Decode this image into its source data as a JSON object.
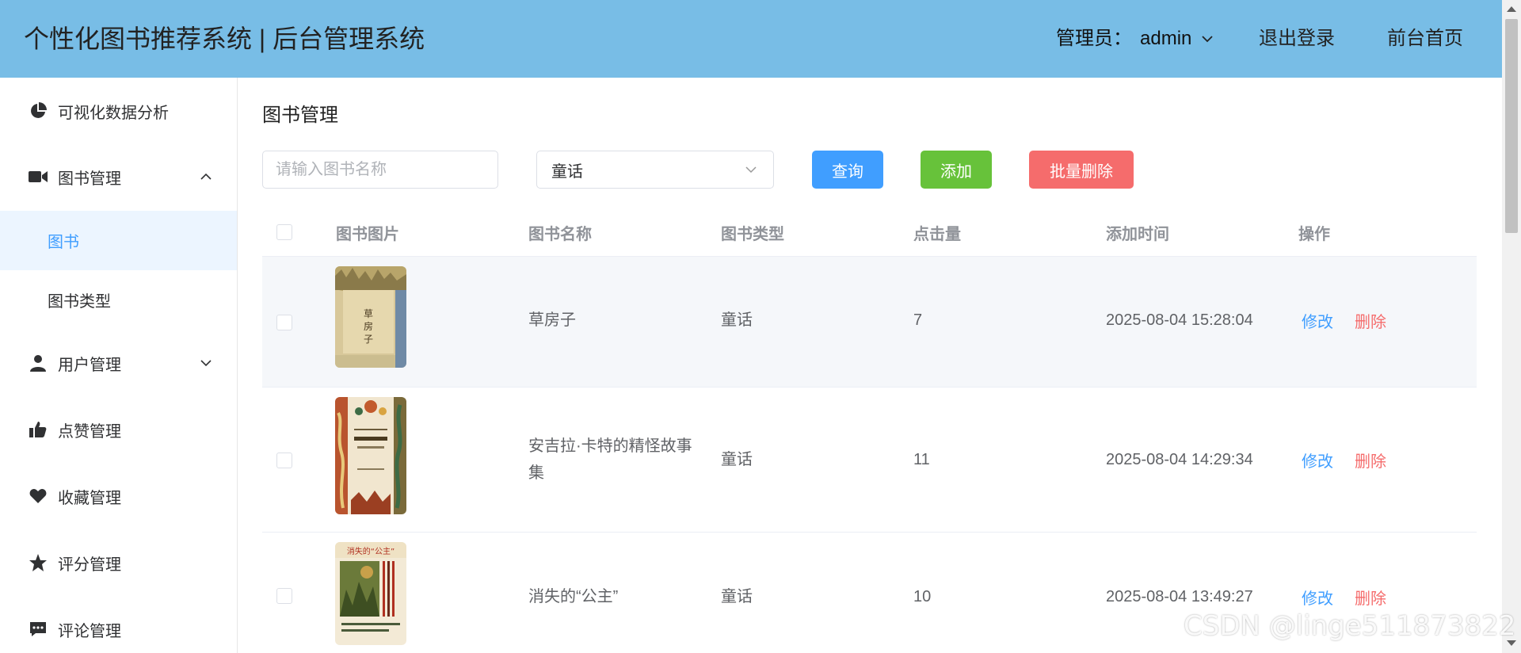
{
  "header": {
    "title": "个性化图书推荐系统 | 后台管理系统",
    "admin_label": "管理员：",
    "admin_name": "admin",
    "logout": "退出登录",
    "front_home": "前台首页",
    "bg_color": "#78bde6"
  },
  "sidebar": {
    "items": [
      {
        "label": "可视化数据分析",
        "icon": "pie-chart-icon"
      },
      {
        "label": "图书管理",
        "icon": "video-camera-icon",
        "expanded": true
      },
      {
        "label": "图书",
        "active": true
      },
      {
        "label": "图书类型"
      },
      {
        "label": "用户管理",
        "icon": "user-icon",
        "expanded": false
      },
      {
        "label": "点赞管理",
        "icon": "thumbs-up-icon"
      },
      {
        "label": "收藏管理",
        "icon": "heart-icon"
      },
      {
        "label": "评分管理",
        "icon": "star-icon"
      },
      {
        "label": "评论管理",
        "icon": "comment-icon"
      }
    ]
  },
  "main": {
    "title": "图书管理",
    "search_placeholder": "请输入图书名称",
    "type_select_value": "童话",
    "query_button": "查询",
    "add_button": "添加",
    "batch_delete_button": "批量删除"
  },
  "table": {
    "headers": [
      "图书图片",
      "图书名称",
      "图书类型",
      "点击量",
      "添加时间",
      "操作"
    ],
    "edit_label": "修改",
    "delete_label": "删除",
    "rows": [
      {
        "name": "草房子",
        "type": "童话",
        "clicks": "7",
        "time": "2025-08-04 15:28:04",
        "cover_text": "草房子"
      },
      {
        "name": "安吉拉·卡特的精怪故事集",
        "type": "童话",
        "clicks": "11",
        "time": "2025-08-04 14:29:34"
      },
      {
        "name": "消失的“公主”",
        "type": "童话",
        "clicks": "10",
        "time": "2025-08-04 13:49:27",
        "cover_text": "消失的“公主”"
      }
    ]
  },
  "colors": {
    "primary": "#409eff",
    "success": "#67c23a",
    "danger": "#f56c6c"
  },
  "watermark": "CSDN @linge511873822"
}
